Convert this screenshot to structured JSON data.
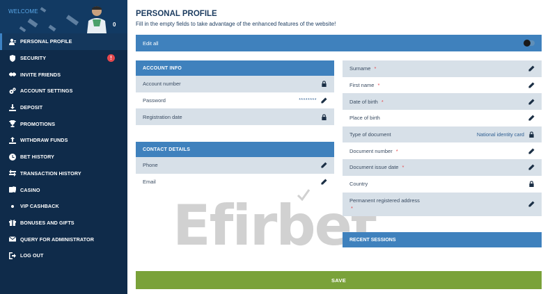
{
  "sidebar": {
    "welcome": "WELCOME",
    "balance": "0",
    "items": [
      {
        "label": "PERSONAL PROFILE",
        "icon": "user-icon",
        "active": true
      },
      {
        "label": "SECURITY",
        "icon": "shield-icon",
        "badge": "!"
      },
      {
        "label": "INVITE FRIENDS",
        "icon": "handshake-icon"
      },
      {
        "label": "ACCOUNT SETTINGS",
        "icon": "gears-icon"
      },
      {
        "label": "DEPOSIT",
        "icon": "download-icon"
      },
      {
        "label": "PROMOTIONS",
        "icon": "trophy-icon"
      },
      {
        "label": "WITHDRAW FUNDS",
        "icon": "upload-icon"
      },
      {
        "label": "BET HISTORY",
        "icon": "clock-icon"
      },
      {
        "label": "TRANSACTION HISTORY",
        "icon": "arrows-icon"
      },
      {
        "label": "CASINO",
        "icon": "cards-icon"
      },
      {
        "label": "VIP CASHBACK",
        "icon": "dot-icon"
      },
      {
        "label": "BONUSES AND GIFTS",
        "icon": "gift-icon"
      },
      {
        "label": "QUERY FOR ADMINISTRATOR",
        "icon": "envelope-icon"
      },
      {
        "label": "LOG OUT",
        "icon": "logout-icon"
      }
    ]
  },
  "main": {
    "title": "PERSONAL PROFILE",
    "subtitle": "Fill in the empty fields to take advantage of the enhanced features of the website!",
    "edit_all": "Edit all",
    "account_info": {
      "header": "ACCOUNT INFO",
      "rows": [
        {
          "label": "Account number",
          "icon": "lock-icon"
        },
        {
          "label": "Password",
          "value": "********",
          "icon": "pencil-icon"
        },
        {
          "label": "Registration date",
          "icon": "lock-icon"
        }
      ]
    },
    "contact_details": {
      "header": "CONTACT DETAILS",
      "rows": [
        {
          "label": "Phone",
          "icon": "pencil-icon"
        },
        {
          "label": "Email",
          "icon": "pencil-icon"
        }
      ]
    },
    "personal_fields": [
      {
        "label": "Surname",
        "required": "*",
        "icon": "pencil-icon"
      },
      {
        "label": "First name",
        "required": "*",
        "icon": "pencil-icon"
      },
      {
        "label": "Date of birth",
        "required": "*",
        "icon": "pencil-icon"
      },
      {
        "label": "Place of birth",
        "icon": "pencil-icon"
      },
      {
        "label": "Type of document",
        "value": "National identity card",
        "icon": "lock-icon"
      },
      {
        "label": "Document number",
        "required": "*",
        "icon": "pencil-icon"
      },
      {
        "label": "Document issue date",
        "required": "*",
        "icon": "pencil-icon"
      },
      {
        "label": "Country",
        "icon": "lock-icon"
      },
      {
        "label": "Permanent registered address",
        "required": "*",
        "icon": "pencil-icon"
      }
    ],
    "recent_sessions": "RECENT SESSIONS",
    "save": "SAVE",
    "watermark": "Efirbet"
  },
  "colors": {
    "sidebar_bg": "#0f2b4a",
    "accent_blue": "#3f81bd",
    "row_shade": "#d7e0e8",
    "save_green": "#7aa23a",
    "required_red": "#e5484d"
  }
}
